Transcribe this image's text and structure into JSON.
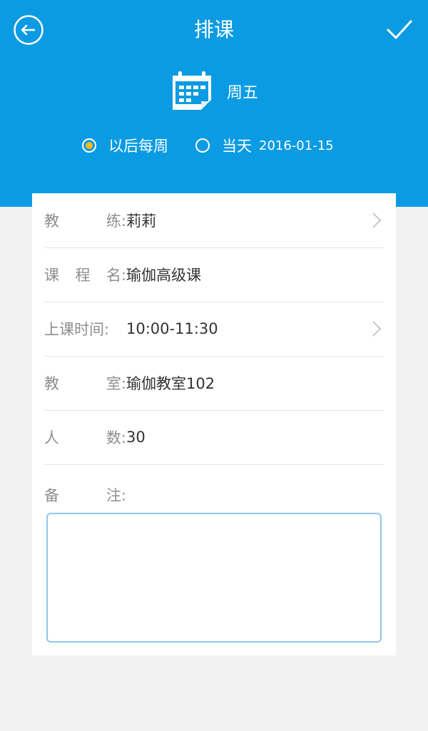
{
  "header": {
    "title": "排课",
    "day": "周五",
    "bg_color": "#0a9be3"
  },
  "repeat": {
    "options": [
      {
        "label": "以后每周",
        "checked": true
      },
      {
        "label": "当天",
        "date": "2016-01-15",
        "checked": false
      }
    ],
    "checked_color": "#f5b91b"
  },
  "form": {
    "coach": {
      "label_chars": [
        "教",
        "练:"
      ],
      "value": "莉莉"
    },
    "course": {
      "label_chars": [
        "课",
        "程",
        "名:"
      ],
      "value": "瑜伽高级课"
    },
    "time": {
      "label_chars": [
        "上课时间:"
      ],
      "value": "10:00-11:30"
    },
    "room": {
      "label_chars": [
        "教",
        "室:"
      ],
      "value": "瑜伽教室102"
    },
    "count": {
      "label_chars": [
        "人",
        "数:"
      ],
      "value": "30"
    },
    "note": {
      "label_chars": [
        "备",
        "注:"
      ],
      "value": ""
    }
  },
  "icons": {
    "back": "back-arrow-circle-icon",
    "confirm": "checkmark-icon",
    "calendar": "calendar-icon",
    "chevron": "chevron-right-icon"
  }
}
